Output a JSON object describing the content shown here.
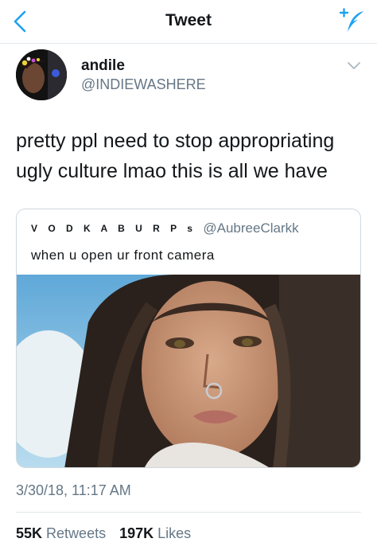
{
  "header": {
    "title": "Tweet",
    "back_icon": "chevron-left-icon",
    "compose_icon": "compose-tweet-icon",
    "accent_color": "#1da1f2"
  },
  "tweet": {
    "author_name": "andile",
    "author_handle": "@INDIEWASHERE",
    "text": "pretty ppl need to stop appropriating ugly culture lmao this is all we have",
    "timestamp": "3/30/18, 11:17 AM",
    "retweets_count": "55K",
    "retweets_label": "Retweets",
    "likes_count": "197K",
    "likes_label": "Likes"
  },
  "quoted_tweet": {
    "author_name": "V O D K A  B U R P s",
    "author_handle": "@AubreeClarkk",
    "text": "when u open ur front camera",
    "media": "selfie-photo"
  },
  "colors": {
    "text_primary": "#14171a",
    "text_secondary": "#657786",
    "border": "#e1e8ed"
  }
}
